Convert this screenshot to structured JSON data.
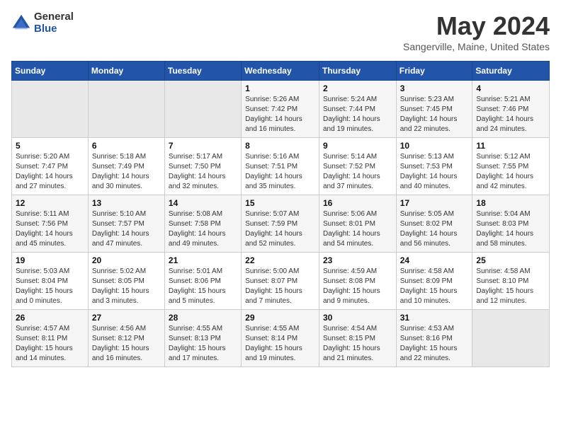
{
  "header": {
    "logo_general": "General",
    "logo_blue": "Blue",
    "title": "May 2024",
    "subtitle": "Sangerville, Maine, United States"
  },
  "days_of_week": [
    "Sunday",
    "Monday",
    "Tuesday",
    "Wednesday",
    "Thursday",
    "Friday",
    "Saturday"
  ],
  "weeks": [
    [
      {
        "day": "",
        "info": ""
      },
      {
        "day": "",
        "info": ""
      },
      {
        "day": "",
        "info": ""
      },
      {
        "day": "1",
        "info": "Sunrise: 5:26 AM\nSunset: 7:42 PM\nDaylight: 14 hours\nand 16 minutes."
      },
      {
        "day": "2",
        "info": "Sunrise: 5:24 AM\nSunset: 7:44 PM\nDaylight: 14 hours\nand 19 minutes."
      },
      {
        "day": "3",
        "info": "Sunrise: 5:23 AM\nSunset: 7:45 PM\nDaylight: 14 hours\nand 22 minutes."
      },
      {
        "day": "4",
        "info": "Sunrise: 5:21 AM\nSunset: 7:46 PM\nDaylight: 14 hours\nand 24 minutes."
      }
    ],
    [
      {
        "day": "5",
        "info": "Sunrise: 5:20 AM\nSunset: 7:47 PM\nDaylight: 14 hours\nand 27 minutes."
      },
      {
        "day": "6",
        "info": "Sunrise: 5:18 AM\nSunset: 7:49 PM\nDaylight: 14 hours\nand 30 minutes."
      },
      {
        "day": "7",
        "info": "Sunrise: 5:17 AM\nSunset: 7:50 PM\nDaylight: 14 hours\nand 32 minutes."
      },
      {
        "day": "8",
        "info": "Sunrise: 5:16 AM\nSunset: 7:51 PM\nDaylight: 14 hours\nand 35 minutes."
      },
      {
        "day": "9",
        "info": "Sunrise: 5:14 AM\nSunset: 7:52 PM\nDaylight: 14 hours\nand 37 minutes."
      },
      {
        "day": "10",
        "info": "Sunrise: 5:13 AM\nSunset: 7:53 PM\nDaylight: 14 hours\nand 40 minutes."
      },
      {
        "day": "11",
        "info": "Sunrise: 5:12 AM\nSunset: 7:55 PM\nDaylight: 14 hours\nand 42 minutes."
      }
    ],
    [
      {
        "day": "12",
        "info": "Sunrise: 5:11 AM\nSunset: 7:56 PM\nDaylight: 14 hours\nand 45 minutes."
      },
      {
        "day": "13",
        "info": "Sunrise: 5:10 AM\nSunset: 7:57 PM\nDaylight: 14 hours\nand 47 minutes."
      },
      {
        "day": "14",
        "info": "Sunrise: 5:08 AM\nSunset: 7:58 PM\nDaylight: 14 hours\nand 49 minutes."
      },
      {
        "day": "15",
        "info": "Sunrise: 5:07 AM\nSunset: 7:59 PM\nDaylight: 14 hours\nand 52 minutes."
      },
      {
        "day": "16",
        "info": "Sunrise: 5:06 AM\nSunset: 8:01 PM\nDaylight: 14 hours\nand 54 minutes."
      },
      {
        "day": "17",
        "info": "Sunrise: 5:05 AM\nSunset: 8:02 PM\nDaylight: 14 hours\nand 56 minutes."
      },
      {
        "day": "18",
        "info": "Sunrise: 5:04 AM\nSunset: 8:03 PM\nDaylight: 14 hours\nand 58 minutes."
      }
    ],
    [
      {
        "day": "19",
        "info": "Sunrise: 5:03 AM\nSunset: 8:04 PM\nDaylight: 15 hours\nand 0 minutes."
      },
      {
        "day": "20",
        "info": "Sunrise: 5:02 AM\nSunset: 8:05 PM\nDaylight: 15 hours\nand 3 minutes."
      },
      {
        "day": "21",
        "info": "Sunrise: 5:01 AM\nSunset: 8:06 PM\nDaylight: 15 hours\nand 5 minutes."
      },
      {
        "day": "22",
        "info": "Sunrise: 5:00 AM\nSunset: 8:07 PM\nDaylight: 15 hours\nand 7 minutes."
      },
      {
        "day": "23",
        "info": "Sunrise: 4:59 AM\nSunset: 8:08 PM\nDaylight: 15 hours\nand 9 minutes."
      },
      {
        "day": "24",
        "info": "Sunrise: 4:58 AM\nSunset: 8:09 PM\nDaylight: 15 hours\nand 10 minutes."
      },
      {
        "day": "25",
        "info": "Sunrise: 4:58 AM\nSunset: 8:10 PM\nDaylight: 15 hours\nand 12 minutes."
      }
    ],
    [
      {
        "day": "26",
        "info": "Sunrise: 4:57 AM\nSunset: 8:11 PM\nDaylight: 15 hours\nand 14 minutes."
      },
      {
        "day": "27",
        "info": "Sunrise: 4:56 AM\nSunset: 8:12 PM\nDaylight: 15 hours\nand 16 minutes."
      },
      {
        "day": "28",
        "info": "Sunrise: 4:55 AM\nSunset: 8:13 PM\nDaylight: 15 hours\nand 17 minutes."
      },
      {
        "day": "29",
        "info": "Sunrise: 4:55 AM\nSunset: 8:14 PM\nDaylight: 15 hours\nand 19 minutes."
      },
      {
        "day": "30",
        "info": "Sunrise: 4:54 AM\nSunset: 8:15 PM\nDaylight: 15 hours\nand 21 minutes."
      },
      {
        "day": "31",
        "info": "Sunrise: 4:53 AM\nSunset: 8:16 PM\nDaylight: 15 hours\nand 22 minutes."
      },
      {
        "day": "",
        "info": ""
      }
    ]
  ]
}
